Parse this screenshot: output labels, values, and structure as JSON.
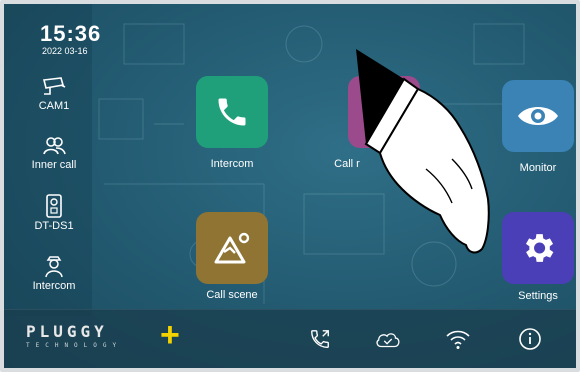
{
  "clock": {
    "time": "15:36",
    "date": "2022 03-16"
  },
  "sidebar": {
    "items": [
      {
        "label": "CAM1",
        "icon": "cctv-camera-icon"
      },
      {
        "label": "Inner call",
        "icon": "users-icon"
      },
      {
        "label": "DT-DS1",
        "icon": "door-station-icon"
      },
      {
        "label": "Intercom",
        "icon": "guard-person-icon"
      }
    ]
  },
  "apps": {
    "intercom": {
      "label": "Intercom",
      "icon": "phone-icon",
      "color": "#1fa07a"
    },
    "call_record": {
      "label": "Call r",
      "icon": "call-record-icon",
      "color": "#9b4b8c"
    },
    "monitor": {
      "label": "Monitor",
      "icon": "eye-icon",
      "color": "#3b83b5"
    },
    "call_scene": {
      "label": "Call scene",
      "icon": "mountain-icon",
      "color": "#8f7434"
    },
    "settings": {
      "label": "Settings",
      "icon": "gear-icon",
      "color": "#4a3fb6"
    }
  },
  "bottom_bar": {
    "logo": {
      "brand": "PLUGGY",
      "sub": "TECHNOLOGY",
      "plus": "+",
      "accent": "#f2d200"
    },
    "icons": [
      "call-forward-icon",
      "cloud-icon",
      "wifi-icon",
      "info-icon"
    ]
  }
}
